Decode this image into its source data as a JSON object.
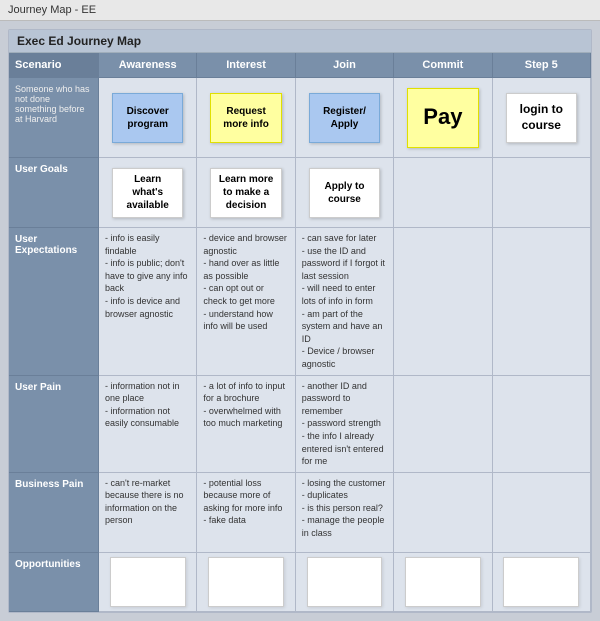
{
  "title": "Journey Map - EE",
  "map_title": "Exec Ed Journey Map",
  "columns": {
    "scenario": "Scenario",
    "awareness": "Awareness",
    "interest": "Interest",
    "join": "Join",
    "commit": "Commit",
    "step5": "Step 5"
  },
  "rows": {
    "scenario": {
      "label": "Scenario",
      "sub_label": "Someone who has not done something before at Harvard",
      "awareness": "Discover program",
      "interest": "Request more info",
      "join": "Register/ Apply",
      "commit": "Pay",
      "step5": "login to course"
    },
    "user_goals": {
      "label": "User Goals",
      "awareness": "Learn what's available",
      "interest": "Learn more to make a decision",
      "join": "Apply to course",
      "commit": "",
      "step5": ""
    },
    "user_expectations": {
      "label": "User Expectations",
      "awareness_items": [
        "info is easily findable",
        "info is public; don't have to give any info back",
        "info is device and browser agnostic"
      ],
      "interest_items": [
        "device and browser agnostic",
        "hand over as little as possible",
        "can opt out or check to get more",
        "understand how info will be used"
      ],
      "join_items": [
        "can save for later",
        "use the ID and password if I forgot it last session",
        "will need to enter lots of info in form",
        "am part of the system and have an ID",
        "Device / browser agnostic"
      ],
      "commit_items": [],
      "step5_items": []
    },
    "user_pain": {
      "label": "User Pain",
      "awareness_items": [
        "information not in one place",
        "information not easily consumable"
      ],
      "interest_items": [
        "a lot of info to input for a brochure",
        "overwhelmed with too much marketing"
      ],
      "join_items": [
        "another ID and password to remember",
        "password strength",
        "the info I already entered isn't entered for me"
      ],
      "commit_items": [],
      "step5_items": []
    },
    "business_pain": {
      "label": "Business Pain",
      "awareness_items": [
        "can't re-market because there is no information on the person"
      ],
      "interest_items": [
        "potential loss because more of asking for more info",
        "fake data"
      ],
      "join_items": [
        "losing the customer",
        "duplicates",
        "is this person real?",
        "manage the people in class"
      ],
      "commit_items": [],
      "step5_items": []
    },
    "opportunities": {
      "label": "Opportunities"
    }
  }
}
